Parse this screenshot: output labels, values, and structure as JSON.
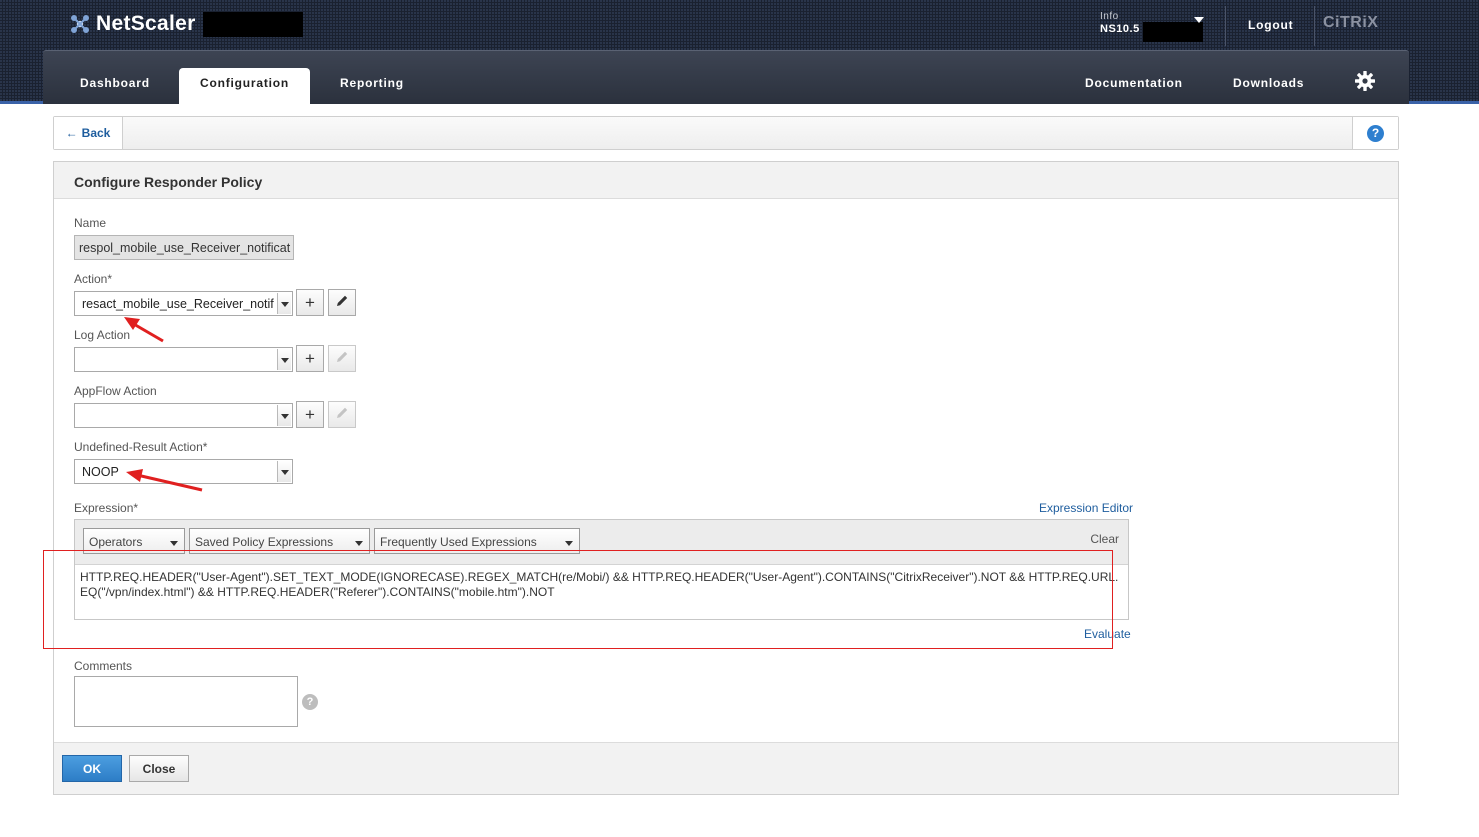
{
  "header": {
    "app_name": "NetScaler",
    "info_label": "Info",
    "info_value": "NS10.5",
    "logout_label": "Logout",
    "brand": "CiTRiX"
  },
  "nav": {
    "tabs": [
      {
        "label": "Dashboard"
      },
      {
        "label": "Configuration",
        "active": true
      },
      {
        "label": "Reporting"
      }
    ],
    "right_links": [
      {
        "label": "Documentation"
      },
      {
        "label": "Downloads"
      }
    ],
    "settings_icon": "gear-icon"
  },
  "backbar": {
    "back_label": "Back",
    "help_label": "?"
  },
  "panel": {
    "title": "Configure Responder Policy",
    "name": {
      "label": "Name",
      "value": "respol_mobile_use_Receiver_notificat"
    },
    "action": {
      "label": "Action*",
      "value": "resact_mobile_use_Receiver_notif"
    },
    "log_action": {
      "label": "Log Action",
      "value": ""
    },
    "appflow_action": {
      "label": "AppFlow Action",
      "value": ""
    },
    "undefined_result_action": {
      "label": "Undefined-Result Action*",
      "value": "NOOP"
    },
    "expression": {
      "label": "Expression*",
      "editor_link": "Expression Editor",
      "operators": "Operators",
      "saved": "Saved Policy Expressions",
      "frequent": "Frequently Used Expressions",
      "clear": "Clear",
      "value": "HTTP.REQ.HEADER(\"User-Agent\").SET_TEXT_MODE(IGNORECASE).REGEX_MATCH(re/Mobi/) && HTTP.REQ.HEADER(\"User-Agent\").CONTAINS(\"CitrixReceiver\").NOT && HTTP.REQ.URL.EQ(\"/vpn/index.html\") && HTTP.REQ.HEADER(\"Referer\").CONTAINS(\"mobile.htm\").NOT",
      "evaluate": "Evaluate"
    },
    "comments": {
      "label": "Comments",
      "value": "",
      "help": "?"
    },
    "ok_label": "OK",
    "close_label": "Close"
  },
  "colors": {
    "accent_blue": "#2d7dc6",
    "link_blue": "#1e5d9e",
    "annotation_red": "#e02020",
    "header_dark": "#1a2130"
  }
}
